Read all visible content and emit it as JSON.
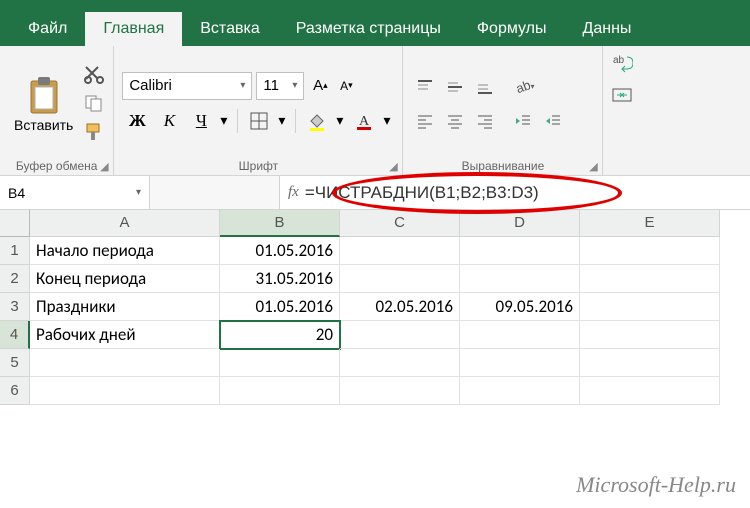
{
  "tabs": {
    "file": "Файл",
    "home": "Главная",
    "insert": "Вставка",
    "layout": "Разметка страницы",
    "formulas": "Формулы",
    "data": "Данны"
  },
  "ribbon": {
    "clipboard_label": "Буфер обмена",
    "paste_label": "Вставить",
    "font_label": "Шрифт",
    "font_name": "Calibri",
    "font_size": "11",
    "bold": "Ж",
    "italic": "К",
    "underline": "Ч",
    "increase_font": "A",
    "decrease_font": "A",
    "font_color_letter": "А",
    "alignment_label": "Выравнивание"
  },
  "namebox": "B4",
  "fx": "fx",
  "formula": "=ЧИСТРАБДНИ(B1;B2;B3:D3)",
  "columns": [
    "A",
    "B",
    "C",
    "D",
    "E"
  ],
  "rows": [
    {
      "n": "1",
      "A": "Начало периода",
      "B": "01.05.2016",
      "C": "",
      "D": "",
      "E": ""
    },
    {
      "n": "2",
      "A": "Конец периода",
      "B": "31.05.2016",
      "C": "",
      "D": "",
      "E": ""
    },
    {
      "n": "3",
      "A": "Праздники",
      "B": "01.05.2016",
      "C": "02.05.2016",
      "D": "09.05.2016",
      "E": ""
    },
    {
      "n": "4",
      "A": "Рабочих дней",
      "B": "20",
      "C": "",
      "D": "",
      "E": ""
    },
    {
      "n": "5",
      "A": "",
      "B": "",
      "C": "",
      "D": "",
      "E": ""
    },
    {
      "n": "6",
      "A": "",
      "B": "",
      "C": "",
      "D": "",
      "E": ""
    }
  ],
  "watermark": "Microsoft-Help.ru"
}
